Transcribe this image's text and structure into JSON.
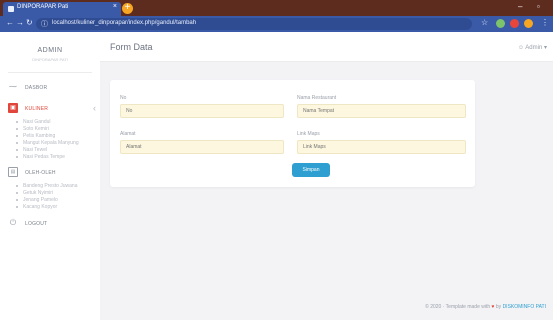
{
  "browser": {
    "tab_title": "DINPORAPAR Pati",
    "tab_close": "×",
    "new_tab": "+",
    "window_controls": [
      "–",
      "▫"
    ],
    "url": "localhost/kuliner_dinporapar/index.php/gandul/tambah",
    "icons": [
      "back-icon",
      "forward-icon",
      "reload-icon",
      "info-icon",
      "star-icon",
      "extension-icon",
      "profile-icon"
    ]
  },
  "sidebar": {
    "brand": "ADMIN",
    "brand_sub": "DINPORAPAR PATI",
    "items": [
      {
        "label": "DASBOR",
        "icon": "chart-icon"
      },
      {
        "label": "KULINER",
        "icon": "utensils-icon",
        "active": true
      },
      {
        "label": "OLEH-OLEH",
        "icon": "gift-icon"
      },
      {
        "label": "LOGOUT",
        "icon": "power-icon"
      }
    ],
    "kuliner_sub": [
      "Nasi Gandul",
      "Soto Kemiri",
      "Petis Kambing",
      "Mangut Kepala Manyung",
      "Nasi Tewel",
      "Nasi Pedas Tempe"
    ],
    "oleh_sub": [
      "Bandeng Presto Juwana",
      "Getuk Nyimiri",
      "Jenang Pamelo",
      "Kacang Kopyor"
    ]
  },
  "header": {
    "title": "Form Data",
    "user": "Admin",
    "user_icon": "user-icon",
    "caret": "▾"
  },
  "form": {
    "fields": [
      {
        "label": "No",
        "placeholder": "No"
      },
      {
        "label": "Nama Restaurant",
        "placeholder": "Nama Tempat"
      },
      {
        "label": "Alamat",
        "placeholder": "Alamat"
      },
      {
        "label": "Link Maps",
        "placeholder": "Link Maps"
      }
    ],
    "submit_label": "Simpan"
  },
  "footer": {
    "text": "© 2020 · Template made with",
    "by": "by",
    "link": "DISKOMINFO PATI"
  },
  "colors": {
    "accent_red": "#e0463b",
    "button_blue": "#2e9fd0",
    "input_bg": "#fdf7df",
    "browser_bar": "#3a5aa8"
  }
}
